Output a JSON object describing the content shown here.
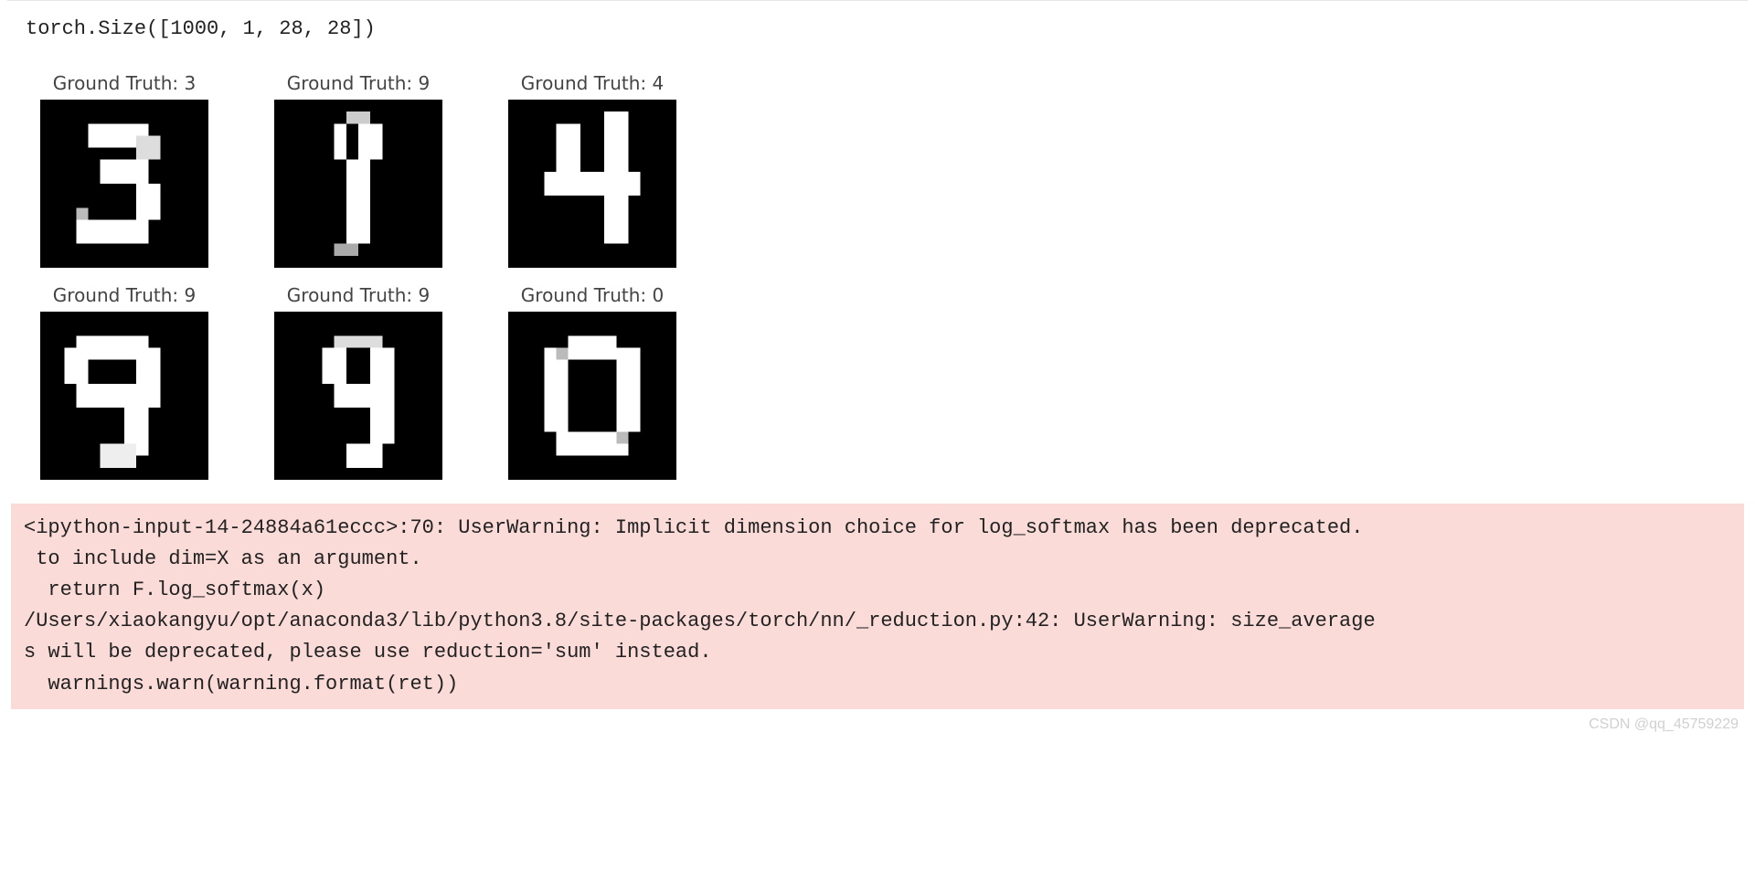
{
  "output_text": "torch.Size([1000, 1, 28, 28])",
  "figures": {
    "row1": [
      {
        "label": "Ground Truth: 3",
        "digit": "3"
      },
      {
        "label": "Ground Truth: 9",
        "digit": "9a"
      },
      {
        "label": "Ground Truth: 4",
        "digit": "4"
      }
    ],
    "row2": [
      {
        "label": "Ground Truth: 9",
        "digit": "9b"
      },
      {
        "label": "Ground Truth: 9",
        "digit": "9c"
      },
      {
        "label": "Ground Truth: 0",
        "digit": "0"
      }
    ]
  },
  "warning_text": "<ipython-input-14-24884a61eccc>:70: UserWarning: Implicit dimension choice for log_softmax has been deprecated. \n to include dim=X as an argument.\n  return F.log_softmax(x)\n/Users/xiaokangyu/opt/anaconda3/lib/python3.8/site-packages/torch/nn/_reduction.py:42: UserWarning: size_average\ns will be deprecated, please use reduction='sum' instead.\n  warnings.warn(warning.format(ret))",
  "watermark": "CSDN @qq_45759229"
}
